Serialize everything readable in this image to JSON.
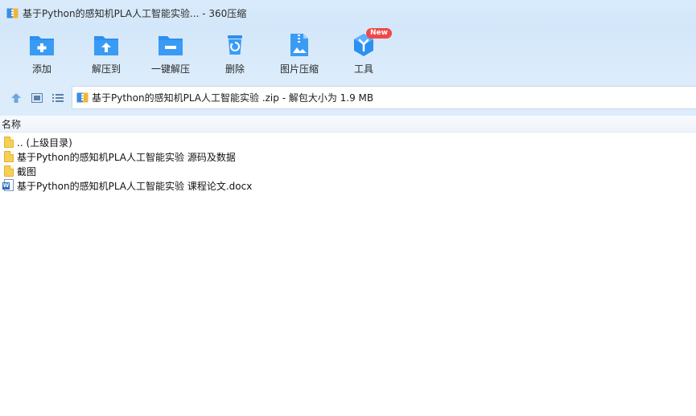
{
  "window": {
    "title": "基于Python的感知机PLA人工智能实验... - 360压缩"
  },
  "toolbar": {
    "items": [
      {
        "label": "添加",
        "icon": "add-folder-icon"
      },
      {
        "label": "解压到",
        "icon": "extract-to-icon"
      },
      {
        "label": "一键解压",
        "icon": "one-click-extract-icon"
      },
      {
        "label": "删除",
        "icon": "delete-icon"
      },
      {
        "label": "图片压缩",
        "icon": "image-compress-icon"
      },
      {
        "label": "工具",
        "icon": "tools-icon",
        "badge": "New"
      }
    ]
  },
  "address": {
    "text": "基于Python的感知机PLA人工智能实验 .zip - 解包大小为 1.9 MB"
  },
  "list": {
    "header": "名称",
    "rows": [
      {
        "name": ".. (上级目录)",
        "icon": "folder-icon"
      },
      {
        "name": "基于Python的感知机PLA人工智能实验 源码及数据",
        "icon": "folder-icon"
      },
      {
        "name": "截图",
        "icon": "folder-icon"
      },
      {
        "name": "基于Python的感知机PLA人工智能实验 课程论文.docx",
        "icon": "word-doc-icon"
      }
    ]
  },
  "colors": {
    "accent": "#2d8ff0",
    "toolbar_bg": "#d3e7fa",
    "badge": "#f04848"
  }
}
